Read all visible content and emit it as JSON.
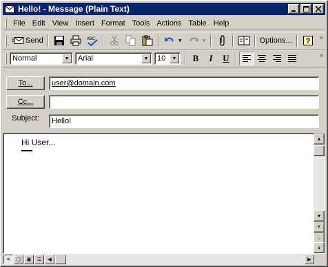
{
  "window": {
    "title": "Hello! - Message (Plain Text)"
  },
  "menubar": {
    "items": [
      "File",
      "Edit",
      "View",
      "Insert",
      "Format",
      "Tools",
      "Actions",
      "Table",
      "Help"
    ]
  },
  "standard_toolbar": {
    "send_label": "Send",
    "options_label": "Options..."
  },
  "format_toolbar": {
    "style_value": "Normal",
    "font_value": "Arial",
    "size_value": "10",
    "bold_label": "B",
    "italic_label": "I",
    "underline_label": "U"
  },
  "header": {
    "to_button_label": "To...",
    "to_value": "user@domain.com",
    "cc_button_label": "Cc...",
    "cc_value": "",
    "subject_label": "Subject:",
    "subject_value": "Hello!"
  },
  "body": {
    "text": "Hi User..."
  },
  "colors": {
    "titlebar": "#0a246a",
    "chrome": "#d4d0c8"
  }
}
